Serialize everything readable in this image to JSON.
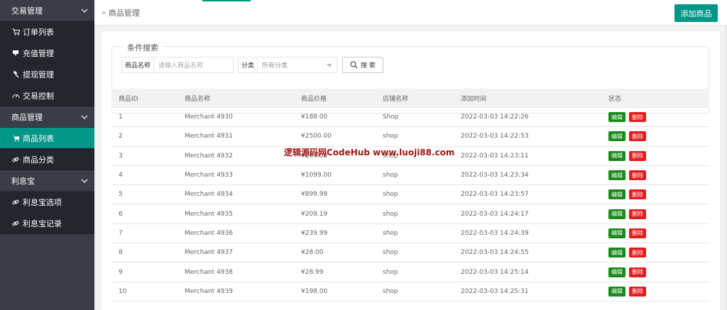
{
  "sidebar": {
    "groups": [
      {
        "label": "交易管理"
      },
      {
        "label": "商品管理"
      },
      {
        "label": "利息宝"
      }
    ],
    "items": [
      {
        "label": "订单列表",
        "icon": "cart-icon"
      },
      {
        "label": "充值管理",
        "icon": "monitor-icon"
      },
      {
        "label": "提现管理",
        "icon": "gavel-icon"
      },
      {
        "label": "交易控制",
        "icon": "gauge-icon"
      },
      {
        "label": "商品列表",
        "icon": "cart-icon"
      },
      {
        "label": "商品分类",
        "icon": "link-icon"
      },
      {
        "label": "利息宝选项",
        "icon": "link-icon"
      },
      {
        "label": "利息宝记录",
        "icon": "link-icon"
      }
    ],
    "active_item": "商品列表"
  },
  "header": {
    "breadcrumb_sep": "»",
    "breadcrumb": "商品管理",
    "add_button": "添加商品"
  },
  "search": {
    "legend": "条件搜索",
    "name_label": "商品名称",
    "name_placeholder": "请输入商品名称",
    "category_label": "分类",
    "category_value": "所有分类",
    "search_button": "搜 索"
  },
  "table": {
    "columns": [
      "商品ID",
      "商品名称",
      "商品价格",
      "店铺名称",
      "添加时间",
      "状态"
    ],
    "edit_label": "编辑",
    "delete_label": "删除",
    "rows": [
      {
        "id": "1",
        "name": "Merchant 4930",
        "price": "¥188.00",
        "shop": "Shop",
        "time": "2022-03-03 14:22:26"
      },
      {
        "id": "2",
        "name": "Merchant 4931",
        "price": "¥2500.00",
        "shop": "shop",
        "time": "2022-03-03 14:22:53"
      },
      {
        "id": "3",
        "name": "Merchant 4932",
        "price": "¥264.00",
        "shop": "shop",
        "time": "2022-03-03 14:23:11"
      },
      {
        "id": "4",
        "name": "Merchant 4933",
        "price": "¥1099.00",
        "shop": "shop",
        "time": "2022-03-03 14:23:34"
      },
      {
        "id": "5",
        "name": "Merchant 4934",
        "price": "¥899.99",
        "shop": "shop",
        "time": "2022-03-03 14:23:57"
      },
      {
        "id": "6",
        "name": "Merchant 4935",
        "price": "¥209.19",
        "shop": "shop",
        "time": "2022-03-03 14:24:17"
      },
      {
        "id": "7",
        "name": "Merchant 4936",
        "price": "¥239.99",
        "shop": "shop",
        "time": "2022-03-03 14:24:39"
      },
      {
        "id": "8",
        "name": "Merchant 4937",
        "price": "¥28.00",
        "shop": "shop",
        "time": "2022-03-03 14:24:55"
      },
      {
        "id": "9",
        "name": "Merchant 4938",
        "price": "¥28.99",
        "shop": "shop",
        "time": "2022-03-03 14:25:14"
      },
      {
        "id": "10",
        "name": "Merchant 4939",
        "price": "¥198.00",
        "shop": "shop",
        "time": "2022-03-03 14:25:31"
      }
    ]
  },
  "watermark": "逻辑源码网CodeHub  www.luoji88.com",
  "colors": {
    "accent": "#009688",
    "sidebar": "#393d49",
    "sidebar_item": "#23262e",
    "edit": "#1a8a1a",
    "delete": "#e31c1c"
  }
}
